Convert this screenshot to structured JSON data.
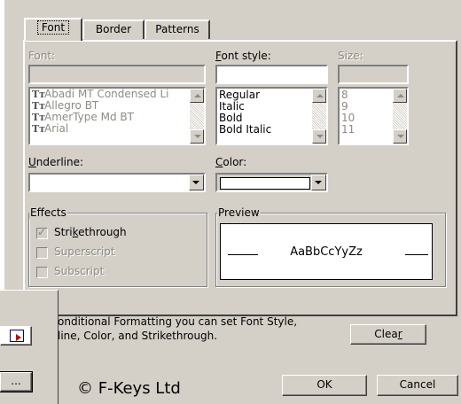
{
  "tabs": [
    {
      "label": "Font",
      "active": true
    },
    {
      "label": "Border",
      "active": false
    },
    {
      "label": "Patterns",
      "active": false
    }
  ],
  "font": {
    "label": "Font:",
    "input_value": "",
    "items": [
      "Abadi MT Condensed Li",
      "Allegro BT",
      "AmerType Md BT",
      "Arial"
    ],
    "item_icon": "truetype-icon"
  },
  "font_style": {
    "label_prefix": "F",
    "label_rest": "ont style:",
    "input_value": "",
    "items": [
      "Regular",
      "Italic",
      "Bold",
      "Bold Italic"
    ]
  },
  "size": {
    "label": "Size:",
    "input_value": "",
    "items": [
      "8",
      "9",
      "10",
      "11"
    ]
  },
  "underline": {
    "label_prefix": "U",
    "label_rest": "nderline:",
    "value": ""
  },
  "color": {
    "label_prefix": "C",
    "label_rest": "olor:",
    "value": ""
  },
  "effects": {
    "title": "Effects",
    "strikethrough": {
      "pre": "Stri",
      "key": "k",
      "post": "ethrough",
      "checked": true
    },
    "superscript": {
      "label": "Superscript"
    },
    "subscript": {
      "label": "Subscript"
    }
  },
  "preview": {
    "title": "Preview",
    "sample": "AaBbCcYyZz"
  },
  "info": {
    "line1": "onditional Formatting you can set Font Style,",
    "line2": "line, Color, and Strikethrough."
  },
  "buttons": {
    "clear_pre": "Clea",
    "clear_key": "r",
    "ok": "OK",
    "cancel": "Cancel",
    "ellipsis": "..."
  },
  "watermark": "© F-Keys Ltd"
}
